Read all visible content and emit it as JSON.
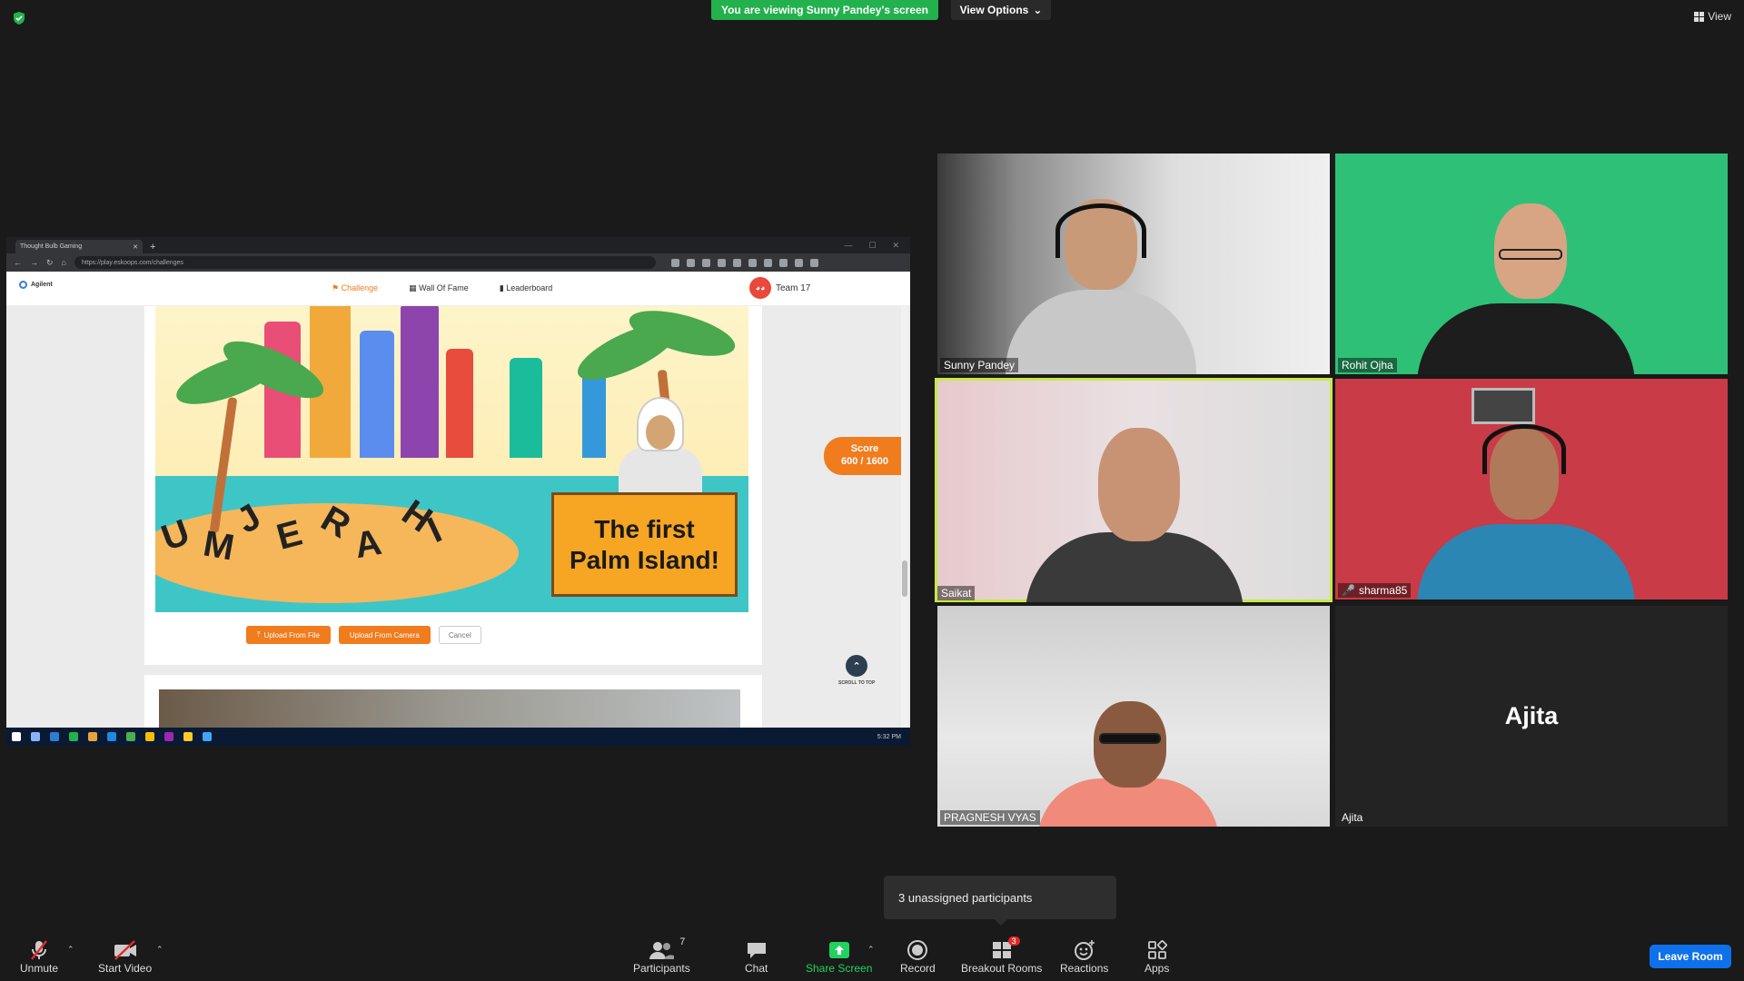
{
  "banner": {
    "viewing": "You are viewing Sunny Pandey's screen",
    "view_options": "View Options",
    "view": "View"
  },
  "browser": {
    "tab_title": "Thought Bulb Gaming",
    "url": "https://play.eskoops.com/challenges"
  },
  "site": {
    "logo": "Agilent",
    "nav": [
      "Challenge",
      "Wall Of Fame",
      "Leaderboard"
    ],
    "team": "Team 17",
    "score_label": "Score",
    "score_value": "600 / 1600",
    "island_letters": [
      "U",
      "M",
      "J",
      "E",
      "R",
      "A",
      "H",
      "I"
    ],
    "sign_line1": "The first",
    "sign_line2": "Palm Island!",
    "btn_upload_file": "Upload From File",
    "btn_upload_camera": "Upload From Camera",
    "btn_cancel": "Cancel",
    "scroll_to_top": "SCROLL TO TOP",
    "taskbar_time": "5:32 PM"
  },
  "participants": [
    {
      "name": "Sunny Pandey"
    },
    {
      "name": "Rohit Ojha"
    },
    {
      "name": "Saikat"
    },
    {
      "name": "sharma85"
    },
    {
      "name": "PRAGNESH VYAS"
    },
    {
      "name": "Ajita",
      "display": "Ajita"
    }
  ],
  "unassigned": "3 unassigned participants",
  "toolbar": {
    "unmute": "Unmute",
    "start_video": "Start Video",
    "participants": "Participants",
    "participants_count": "7",
    "chat": "Chat",
    "share_screen": "Share Screen",
    "record": "Record",
    "breakout_rooms": "Breakout Rooms",
    "breakout_badge": "3",
    "reactions": "Reactions",
    "apps": "Apps",
    "leave_room": "Leave Room"
  },
  "colors": {
    "accent_orange": "#f07c1d",
    "zoom_green": "#23b14d",
    "leave_blue": "#0e71eb",
    "speaker_outline": "#c9e84a"
  }
}
